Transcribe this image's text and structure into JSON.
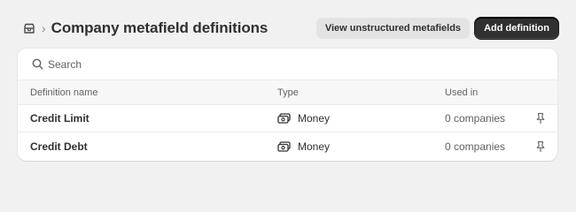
{
  "header": {
    "title": "Company metafield definitions",
    "breadcrumb_separator": "›",
    "breadcrumb_icon": "store-icon",
    "secondary_button": "View unstructured metafields",
    "primary_button": "Add definition"
  },
  "search": {
    "placeholder": "Search",
    "value": ""
  },
  "table": {
    "columns": [
      "Definition name",
      "Type",
      "Used in"
    ],
    "rows": [
      {
        "name": "Credit Limit",
        "type": "Money",
        "type_icon": "money-icon",
        "used_in": "0 companies",
        "action_icon": "pin-icon"
      },
      {
        "name": "Credit Debt",
        "type": "Money",
        "type_icon": "money-icon",
        "used_in": "0 companies",
        "action_icon": "pin-icon"
      }
    ]
  }
}
